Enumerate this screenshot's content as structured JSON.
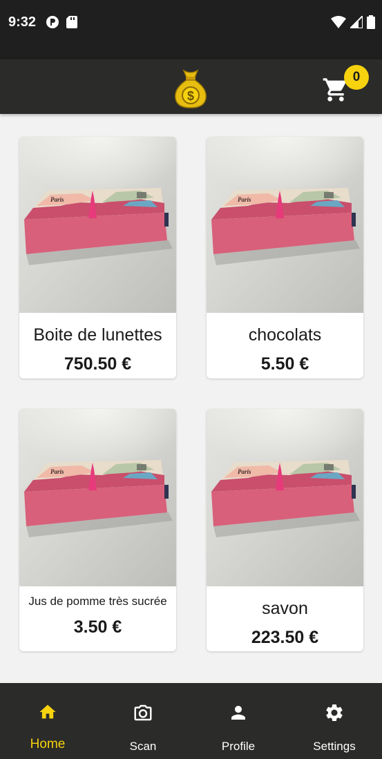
{
  "status_bar": {
    "time": "9:32"
  },
  "header": {
    "logo_icon": "money-bag-dollar-icon",
    "cart_icon": "shopping-cart-icon",
    "cart_count": "0",
    "accent_color": "#f6d20f"
  },
  "products": [
    {
      "name": "Boite de lunettes",
      "price": "750.50 €"
    },
    {
      "name": "chocolats",
      "price": "5.50 €"
    },
    {
      "name": "Jus de pomme très sucrée",
      "price": "3.50 €"
    },
    {
      "name": "savon",
      "price": "223.50 €"
    }
  ],
  "nav": {
    "items": [
      {
        "label": "Home",
        "icon": "home-icon",
        "active": true
      },
      {
        "label": "Scan",
        "icon": "camera-icon",
        "active": false
      },
      {
        "label": "Profile",
        "icon": "person-icon",
        "active": false
      },
      {
        "label": "Settings",
        "icon": "gear-icon",
        "active": false
      }
    ]
  }
}
